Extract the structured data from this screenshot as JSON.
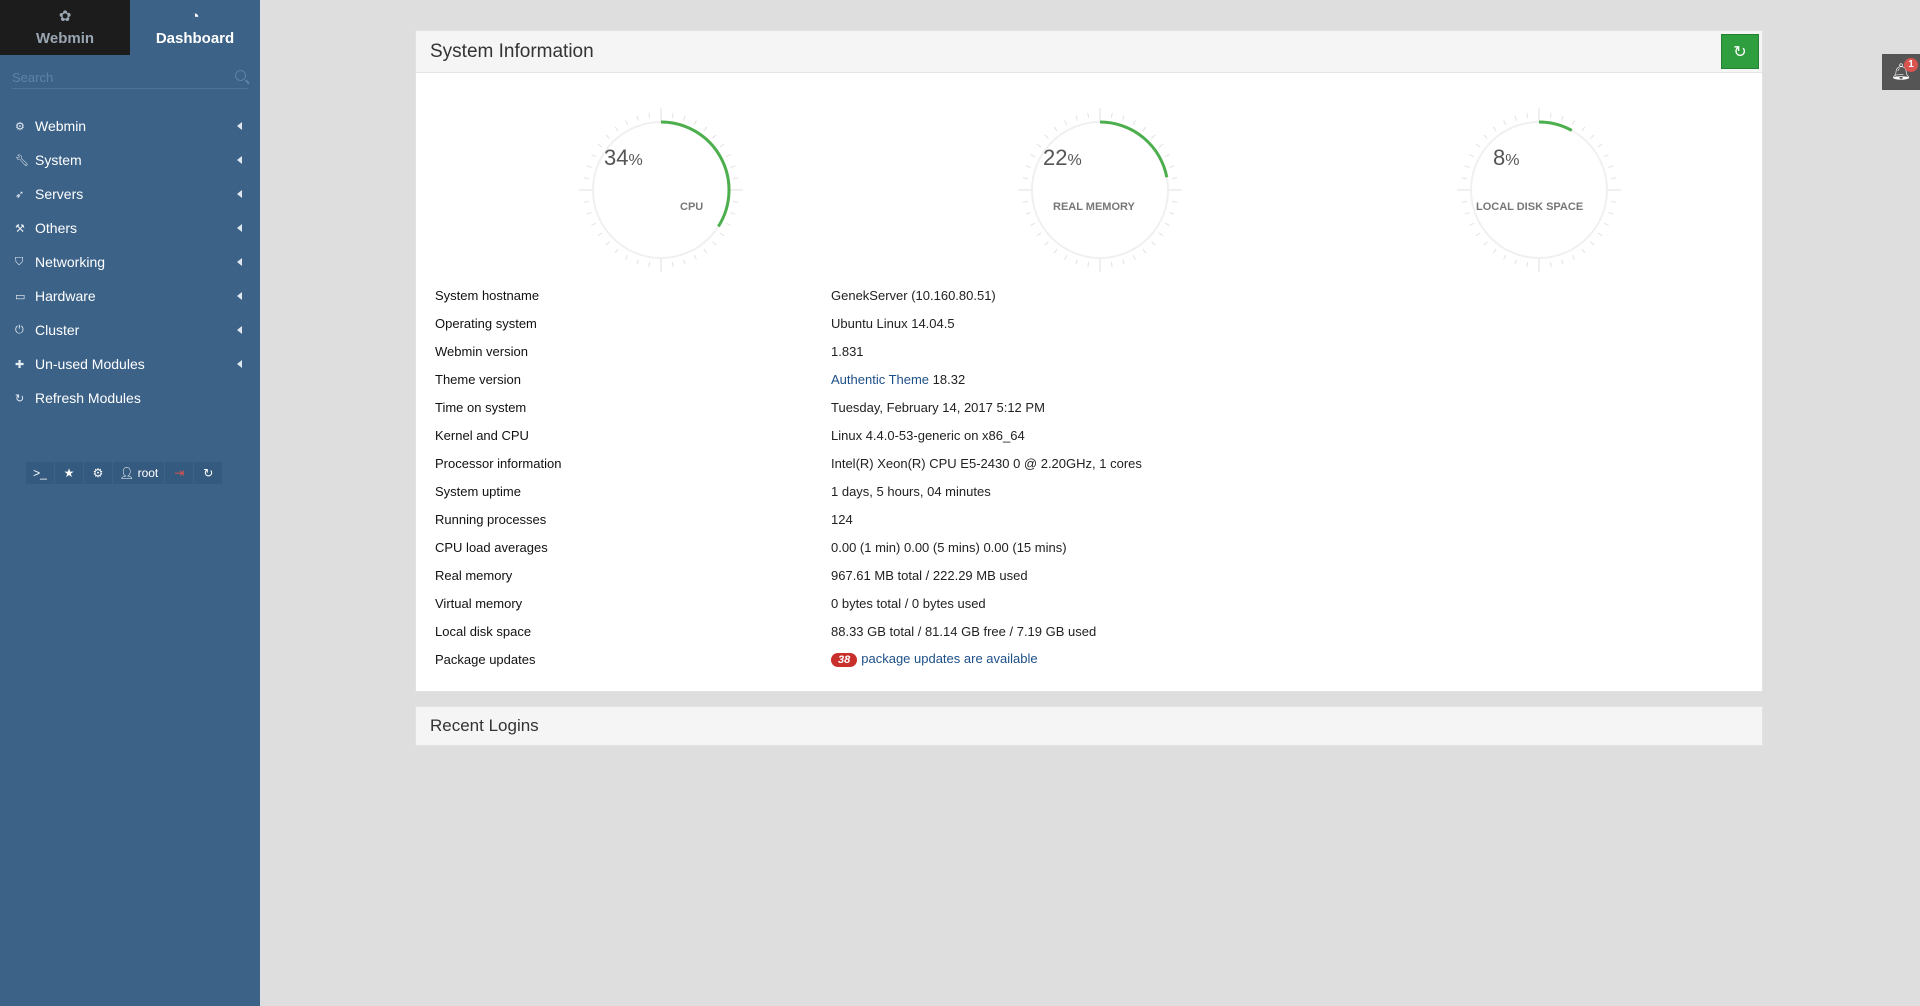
{
  "sidebar": {
    "tabs": [
      {
        "label": "Webmin",
        "icon": "webmin-logo-icon"
      },
      {
        "label": "Dashboard",
        "icon": "dashboard-icon"
      }
    ],
    "search_placeholder": "Search",
    "items": [
      {
        "label": "Webmin",
        "icon": "gear-icon"
      },
      {
        "label": "System",
        "icon": "wrench-icon"
      },
      {
        "label": "Servers",
        "icon": "rocket-icon"
      },
      {
        "label": "Others",
        "icon": "tools-icon"
      },
      {
        "label": "Networking",
        "icon": "shield-icon"
      },
      {
        "label": "Hardware",
        "icon": "hdd-icon"
      },
      {
        "label": "Cluster",
        "icon": "power-icon"
      },
      {
        "label": "Un-used Modules",
        "icon": "puzzle-icon"
      },
      {
        "label": "Refresh Modules",
        "icon": "refresh-icon"
      }
    ],
    "toolbar": {
      "terminal": ">_",
      "user": "root"
    }
  },
  "system_info": {
    "title": "System Information",
    "gauges": [
      {
        "label": "CPU",
        "value": 34,
        "unit": "%"
      },
      {
        "label": "REAL MEMORY",
        "value": 22,
        "unit": "%"
      },
      {
        "label": "LOCAL DISK SPACE",
        "value": 8,
        "unit": "%"
      }
    ],
    "rows": [
      {
        "key": "System hostname",
        "value": "GenekServer (10.160.80.51)"
      },
      {
        "key": "Operating system",
        "value": "Ubuntu Linux 14.04.5"
      },
      {
        "key": "Webmin version",
        "value": "1.831"
      },
      {
        "key": "Theme version",
        "link": "Authentic Theme",
        "value": " 18.32"
      },
      {
        "key": "Time on system",
        "value": "Tuesday, February 14, 2017 5:12 PM"
      },
      {
        "key": "Kernel and CPU",
        "value": "Linux 4.4.0-53-generic on x86_64"
      },
      {
        "key": "Processor information",
        "value": "Intel(R) Xeon(R) CPU E5-2430 0 @ 2.20GHz, 1 cores"
      },
      {
        "key": "System uptime",
        "value": "1 days, 5 hours, 04 minutes"
      },
      {
        "key": "Running processes",
        "value": "124"
      },
      {
        "key": "CPU load averages",
        "value": "0.00 (1 min) 0.00 (5 mins) 0.00 (15 mins)"
      },
      {
        "key": "Real memory",
        "value": "967.61 MB total / 222.29 MB used"
      },
      {
        "key": "Virtual memory",
        "value": "0 bytes total / 0 bytes used"
      },
      {
        "key": "Local disk space",
        "value": "88.33 GB total / 81.14 GB free / 7.19 GB used"
      },
      {
        "key": "Package updates",
        "badge": "38",
        "value": "package updates are available"
      }
    ]
  },
  "recent_logins": {
    "title": "Recent Logins"
  },
  "notifications": {
    "count": "1"
  },
  "colors": {
    "gauge": "#4cae4c",
    "sidebar": "#3c6288",
    "link": "#1d4f87",
    "accent_green": "#2f9e3f"
  }
}
